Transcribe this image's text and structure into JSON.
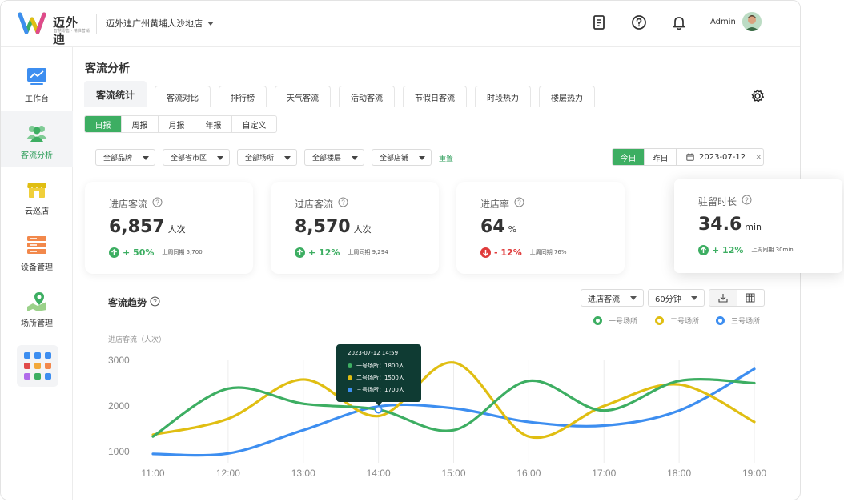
{
  "header": {
    "brand": "迈外迪",
    "brand_tagline": "智慧零售 · 精准营销",
    "store": "迈外迪广州黄埔大沙地店",
    "user": "Admin"
  },
  "sidebar": {
    "items": [
      {
        "label": "工作台",
        "icon": "dashboard-chart-icon"
      },
      {
        "label": "客流分析",
        "icon": "people-icon"
      },
      {
        "label": "云巡店",
        "icon": "store-icon"
      },
      {
        "label": "设备管理",
        "icon": "server-icon"
      },
      {
        "label": "场所管理",
        "icon": "map-pin-icon"
      }
    ],
    "active": "客流分析"
  },
  "page": {
    "title": "客流分析"
  },
  "tabs": [
    "客流统计",
    "客流对比",
    "排行榜",
    "天气客流",
    "活动客流",
    "节假日客流",
    "时段热力",
    "楼层热力"
  ],
  "periods": [
    "日报",
    "周报",
    "月报",
    "年报",
    "自定义"
  ],
  "filters": [
    "全部品牌",
    "全部省市区",
    "全部场所",
    "全部楼层",
    "全部店铺"
  ],
  "reset_label": "重置",
  "date": {
    "today": "今日",
    "yesterday": "昨日",
    "value": "2023-07-12",
    "clear": "×"
  },
  "kpis": [
    {
      "label": "进店客流",
      "value": "6,857",
      "unit": "人次",
      "change": "+ 50%",
      "direction": "up",
      "compare": "上周同期 5,700"
    },
    {
      "label": "过店客流",
      "value": "8,570",
      "unit": "人次",
      "change": "+ 12%",
      "direction": "up",
      "compare": "上周同期 9,294"
    },
    {
      "label": "进店率",
      "value": "64",
      "unit": "%",
      "change": "- 12%",
      "direction": "down",
      "compare": "上周同期 76%"
    },
    {
      "label": "驻留时长",
      "value": "34.6",
      "unit": "min",
      "change": "+ 12%",
      "direction": "up",
      "compare": "上周同期 30min"
    }
  ],
  "chart_section": {
    "title": "客流趋势",
    "metric_select": "进店客流",
    "interval_select": "60分钟"
  },
  "colors": {
    "green": "#3dae62",
    "yellow": "#e0be12",
    "blue": "#3d8ef0",
    "red": "#e03b3b",
    "tooltip_bg": "#0f3b33"
  },
  "tooltip": {
    "time": "2023-07-12  14:59",
    "rows": [
      "一号场所：1800人",
      "二号场所：1500人",
      "三号场所：1700人"
    ]
  },
  "chart_data": {
    "type": "line",
    "title": "",
    "xlabel": "",
    "ylabel": "进店客流（人次）",
    "x": [
      "11:00",
      "12:00",
      "13:00",
      "14:00",
      "15:00",
      "16:00",
      "17:00",
      "18:00",
      "19:00"
    ],
    "yticks": [
      1000,
      2000,
      3000
    ],
    "ylim": [
      1000,
      3000
    ],
    "grid": "vertical",
    "legend": "top-right",
    "series": [
      {
        "name": "一号场所",
        "color": "#3dae62",
        "values": [
          1330,
          2380,
          2050,
          1920,
          1470,
          2550,
          1900,
          2550,
          2500
        ]
      },
      {
        "name": "二号场所",
        "color": "#e0be12",
        "values": [
          1370,
          1720,
          2580,
          1780,
          2950,
          1330,
          2000,
          2470,
          1650
        ]
      },
      {
        "name": "三号场所",
        "color": "#3d8ef0",
        "values": [
          950,
          960,
          1470,
          1990,
          1950,
          1650,
          1570,
          1900,
          2810
        ]
      }
    ]
  }
}
